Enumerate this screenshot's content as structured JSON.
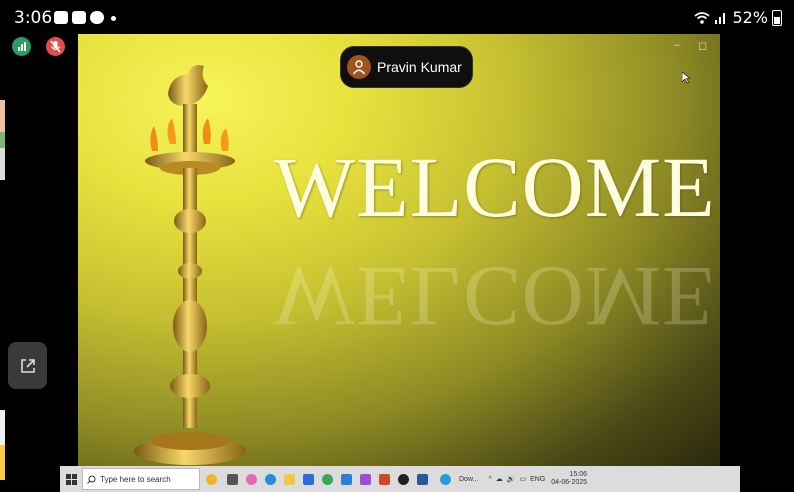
{
  "status_bar": {
    "time": "3:06",
    "battery": "52%"
  },
  "meeting": {
    "participant_name": "Pravin Kumar"
  },
  "slide": {
    "heading": "WELCOME"
  },
  "taskbar": {
    "search_placeholder": "Type here to search",
    "download_label": "Dow...",
    "language": "ENG",
    "time": "15:06",
    "date": "04-06-2025"
  },
  "colors": {
    "slide_accent": "#e8e23e",
    "mic_muted": "#e0504a",
    "signal": "#2e9b63"
  },
  "icons": [
    "gallery-icon",
    "youtube-icon",
    "wifi-icon",
    "signal-icon",
    "battery-icon",
    "share-screen-icon",
    "person-icon",
    "windows-logo-icon",
    "search-icon"
  ]
}
